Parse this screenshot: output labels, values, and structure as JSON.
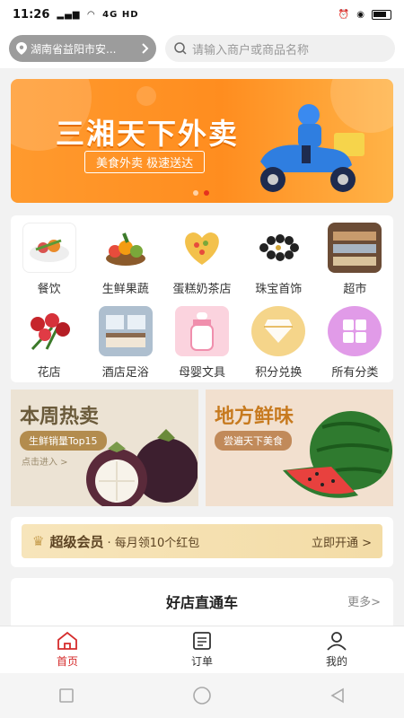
{
  "status": {
    "time": "11:26",
    "signal": "4G HD"
  },
  "location": {
    "label": "湖南省益阳市安..."
  },
  "search": {
    "placeholder": "请输入商户或商品名称"
  },
  "banner": {
    "title": "三湘天下外卖",
    "subtitle": "美食外卖  极速送达"
  },
  "categories": [
    {
      "label": "餐饮",
      "icon": "food-plate",
      "color": "#d9534f"
    },
    {
      "label": "生鲜果蔬",
      "icon": "fruit-basket",
      "color": "#7aa83a"
    },
    {
      "label": "蛋糕奶茶店",
      "icon": "cake",
      "color": "#f3c14b"
    },
    {
      "label": "珠宝首饰",
      "icon": "bracelet",
      "color": "#444444"
    },
    {
      "label": "超市",
      "icon": "shelves",
      "color": "#8a6a4f"
    },
    {
      "label": "花店",
      "icon": "roses",
      "color": "#c6252b"
    },
    {
      "label": "酒店足浴",
      "icon": "hotel-room",
      "color": "#7b96b0"
    },
    {
      "label": "母婴文具",
      "icon": "baby-bottle",
      "color": "#f3a3b9"
    },
    {
      "label": "积分兑换",
      "icon": "diamond",
      "color": "#e0a93a"
    },
    {
      "label": "所有分类",
      "icon": "grid",
      "color": "#c86bd3"
    }
  ],
  "promos": {
    "left": {
      "title": "本周热卖",
      "tag": "生鲜销量Top15",
      "link": "点击进入 >"
    },
    "right": {
      "title": "地方鲜味",
      "tag": "尝遍天下美食"
    }
  },
  "vip": {
    "name": "超级会员",
    "desc": "· 每月领10个红包",
    "action": "立即开通 >"
  },
  "stores": {
    "title": "好店直通车",
    "more": "更多>"
  },
  "tabs": [
    {
      "label": "首页",
      "icon": "home-icon",
      "active": true
    },
    {
      "label": "订单",
      "icon": "order-icon",
      "active": false
    },
    {
      "label": "我的",
      "icon": "profile-icon",
      "active": false
    }
  ]
}
